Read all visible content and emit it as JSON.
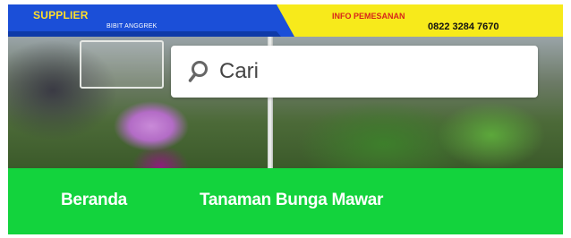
{
  "header": {
    "brand_title": "SUPPLIER",
    "brand_subtitle": "BIBIT ANGGREK",
    "contact_label": "INFO PEMESANAN",
    "contact_phone": "0822 3284 7670"
  },
  "search": {
    "placeholder": "Cari",
    "icon": "search-icon"
  },
  "nav": {
    "items": [
      {
        "label": "Beranda"
      },
      {
        "label": "Tanaman Bunga Mawar"
      }
    ]
  },
  "colors": {
    "banner_blue": "#1b4fd8",
    "banner_yellow": "#f7ea1b",
    "nav_green": "#13d33d"
  }
}
